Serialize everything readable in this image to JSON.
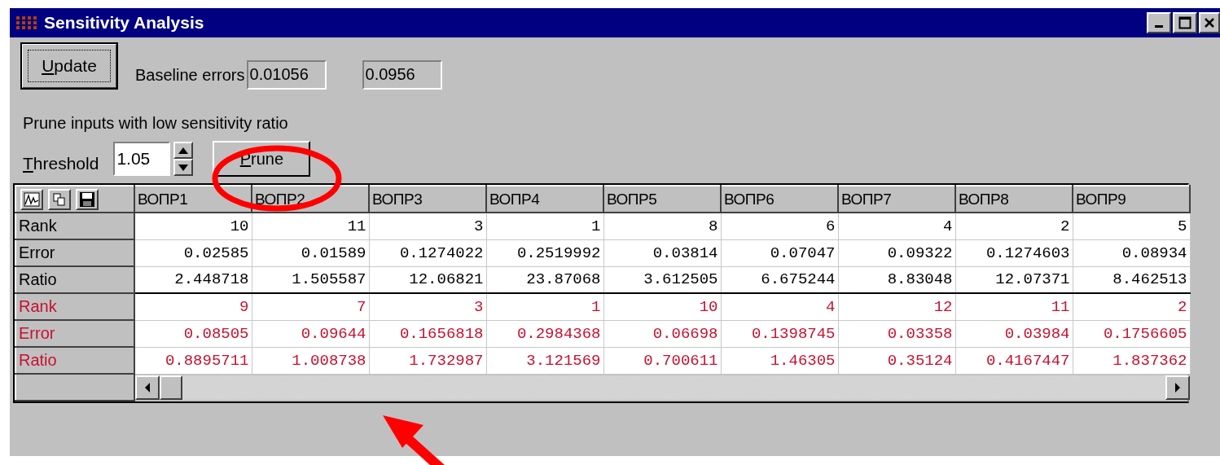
{
  "window": {
    "title": "Sensitivity Analysis"
  },
  "update_button": "Update",
  "baseline": {
    "label": "Baseline errors",
    "values": [
      "0.01056",
      "0.0956"
    ]
  },
  "prune_label": "Prune inputs with low sensitivity ratio",
  "threshold": {
    "label": "Threshold",
    "value": "1.05"
  },
  "prune_button": "Prune",
  "table": {
    "columns": [
      "ВОПР1",
      "ВОПР2",
      "ВОПР3",
      "ВОПР4",
      "ВОПР5",
      "ВОПР6",
      "ВОПР7",
      "ВОПР8",
      "ВОПР9"
    ],
    "rows": [
      {
        "label": "Rank",
        "kind": "first",
        "cells": [
          "10",
          "11",
          "3",
          "1",
          "8",
          "6",
          "4",
          "2",
          "5"
        ]
      },
      {
        "label": "Error",
        "kind": "first",
        "cells": [
          "0.02585",
          "0.01589",
          "0.1274022",
          "0.2519992",
          "0.03814",
          "0.07047",
          "0.09322",
          "0.1274603",
          "0.08934"
        ]
      },
      {
        "label": "Ratio",
        "kind": "first",
        "cells": [
          "2.448718",
          "1.505587",
          "12.06821",
          "23.87068",
          "3.612505",
          "6.675244",
          "8.83048",
          "12.07371",
          "8.462513"
        ]
      },
      {
        "label": "Rank",
        "kind": "second",
        "cells": [
          "9",
          "7",
          "3",
          "1",
          "10",
          "4",
          "12",
          "11",
          "2"
        ]
      },
      {
        "label": "Error",
        "kind": "second",
        "cells": [
          "0.08505",
          "0.09644",
          "0.1656818",
          "0.2984368",
          "0.06698",
          "0.1398745",
          "0.03358",
          "0.03984",
          "0.1756605"
        ]
      },
      {
        "label": "Ratio",
        "kind": "second",
        "cells": [
          "0.8895711",
          "1.008738",
          "1.732987",
          "3.121569",
          "0.700611",
          "1.46305",
          "0.35124",
          "0.4167447",
          "1.837362"
        ]
      }
    ]
  }
}
